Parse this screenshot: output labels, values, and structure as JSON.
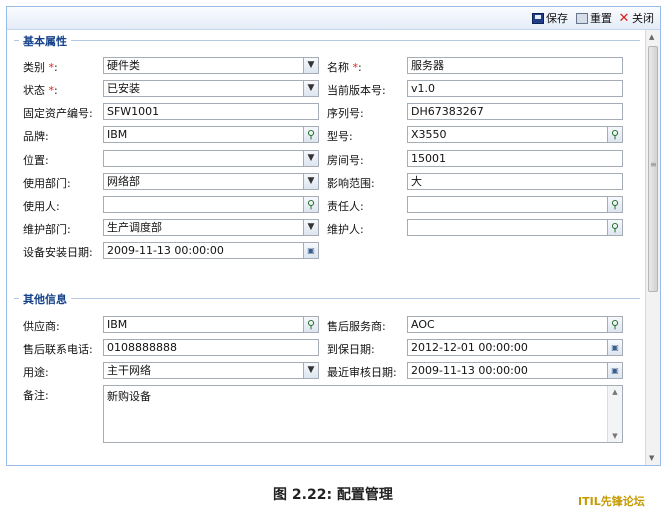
{
  "toolbar": {
    "save": "保存",
    "reset": "重置",
    "close": "关闭"
  },
  "basic": {
    "legend": "基本属性",
    "category_label": "类别",
    "category_value": "硬件类",
    "name_label": "名称",
    "name_value": "服务器",
    "status_label": "状态",
    "status_value": "已安装",
    "version_label": "当前版本号:",
    "version_value": "v1.0",
    "asset_label": "固定资产编号:",
    "asset_value": "SFW1001",
    "serial_label": "序列号:",
    "serial_value": "DH67383267",
    "brand_label": "品牌:",
    "brand_value": "IBM",
    "model_label": "型号:",
    "model_value": "X3550",
    "location_label": "位置:",
    "location_value": "",
    "room_label": "房间号:",
    "room_value": "15001",
    "dept_label": "使用部门:",
    "dept_value": "网络部",
    "impact_label": "影响范围:",
    "impact_value": "大",
    "user_label": "使用人:",
    "user_value": "",
    "owner_label": "责任人:",
    "owner_value": "",
    "maint_dept_label": "维护部门:",
    "maint_dept_value": "生产调度部",
    "maintainer_label": "维护人:",
    "maintainer_value": "",
    "install_date_label": "设备安装日期:",
    "install_date_value": "2009-11-13 00:00:00"
  },
  "other": {
    "legend": "其他信息",
    "supplier_label": "供应商:",
    "supplier_value": "IBM",
    "service_label": "售后服务商:",
    "service_value": "AOC",
    "phone_label": "售后联系电话:",
    "phone_value": "0108888888",
    "expire_label": "到保日期:",
    "expire_value": "2012-12-01 00:00:00",
    "usage_label": "用途:",
    "usage_value": "主干网络",
    "audit_label": "最近审核日期:",
    "audit_value": "2009-11-13 00:00:00",
    "remark_label": "备注:",
    "remark_value": "新购设备"
  },
  "caption": "图 2.22: 配置管理",
  "watermark": "ITIL先锋论坛",
  "required_mark": "*",
  "colon": ":"
}
